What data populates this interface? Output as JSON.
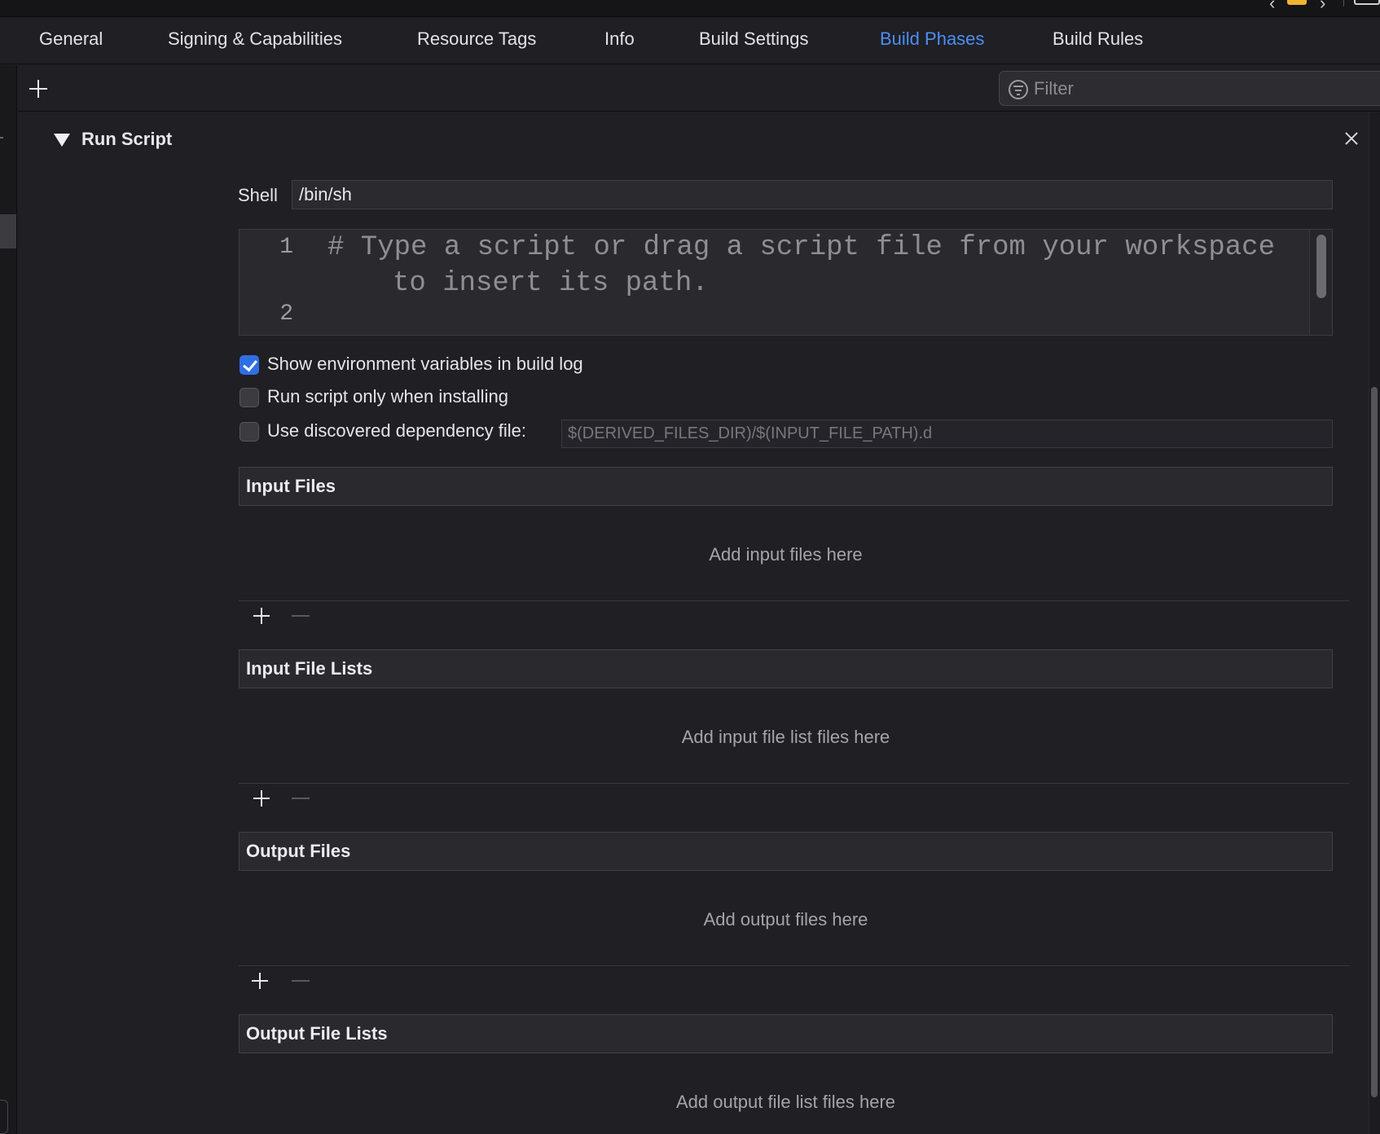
{
  "tabs": [
    {
      "label": "General",
      "active": false
    },
    {
      "label": "Signing & Capabilities",
      "active": false
    },
    {
      "label": "Resource Tags",
      "active": false
    },
    {
      "label": "Info",
      "active": false
    },
    {
      "label": "Build Settings",
      "active": false
    },
    {
      "label": "Build Phases",
      "active": true
    },
    {
      "label": "Build Rules",
      "active": false
    }
  ],
  "filter": {
    "placeholder": "Filter"
  },
  "phase": {
    "title": "Run Script",
    "shell_label": "Shell",
    "shell_value": "/bin/sh",
    "editor": {
      "line_numbers": [
        "1",
        "2"
      ],
      "line1": "# Type a script or drag a script file from your workspace",
      "line1_wrap": "to insert its path.",
      "line2": ""
    },
    "options": {
      "show_env": {
        "label": "Show environment variables in build log",
        "checked": true
      },
      "run_installing": {
        "label": "Run script only when installing",
        "checked": false
      },
      "dependency": {
        "label": "Use discovered dependency file:",
        "checked": false,
        "placeholder": "$(DERIVED_FILES_DIR)/$(INPUT_FILE_PATH).d"
      }
    },
    "sections": [
      {
        "title": "Input Files",
        "empty": "Add input files here"
      },
      {
        "title": "Input File Lists",
        "empty": "Add input file list files here"
      },
      {
        "title": "Output Files",
        "empty": "Add output files here"
      },
      {
        "title": "Output File Lists",
        "empty": "Add output file list files here"
      }
    ]
  },
  "colors": {
    "accent": "#4d8ef3",
    "background": "#1f1f24",
    "checkbox_checked": "#2f6fe4"
  }
}
